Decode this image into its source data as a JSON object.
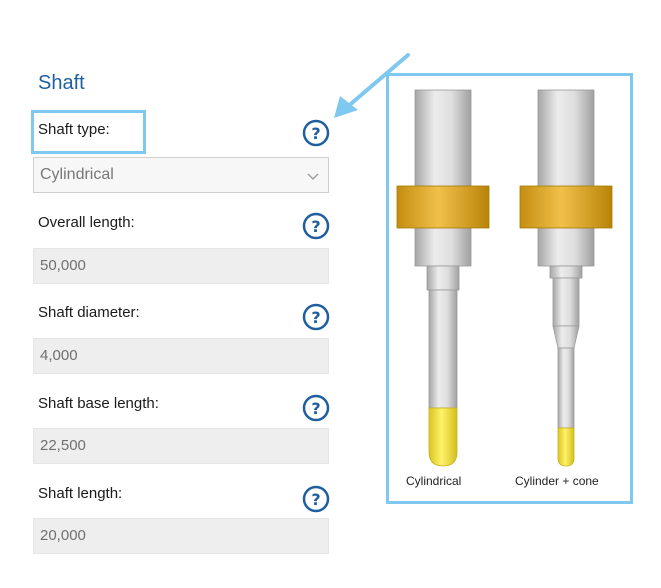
{
  "section": {
    "title": "Shaft"
  },
  "fields": {
    "shaft_type": {
      "label": "Shaft type:",
      "value": "Cylindrical"
    },
    "overall_length": {
      "label": "Overall length:",
      "value": "50,000"
    },
    "shaft_diameter": {
      "label": "Shaft diameter:",
      "value": "4,000"
    },
    "shaft_base_length": {
      "label": "Shaft base length:",
      "value": "22,500"
    },
    "shaft_length": {
      "label": "Shaft length:",
      "value": "20,000"
    }
  },
  "help": {
    "glyph": "?"
  },
  "figure": {
    "captions": [
      "Cylindrical",
      "Cylinder + cone"
    ]
  },
  "colors": {
    "highlight": "#7fc8f0",
    "title": "#1f5f9f",
    "help_ring": "#1f5f9f",
    "collar": "#d9a520",
    "tip": "#f1e040"
  },
  "icons": [
    "help-icon",
    "chevron-down-icon",
    "arrow-icon"
  ]
}
